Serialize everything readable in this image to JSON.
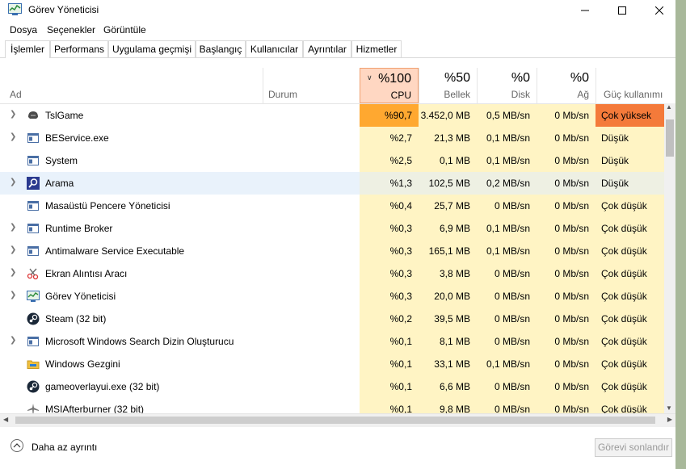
{
  "window": {
    "title": "Görev Yöneticisi"
  },
  "menu": [
    "Dosya",
    "Seçenekler",
    "Görüntüle"
  ],
  "tabs": [
    "İşlemler",
    "Performans",
    "Uygulama geçmişi",
    "Başlangıç",
    "Kullanıcılar",
    "Ayrıntılar",
    "Hizmetler"
  ],
  "columns": {
    "name": "Ad",
    "status": "Durum",
    "cpu": {
      "pct": "%100",
      "label": "CPU"
    },
    "mem": {
      "pct": "%50",
      "label": "Bellek"
    },
    "disk": {
      "pct": "%0",
      "label": "Disk"
    },
    "net": {
      "pct": "%0",
      "label": "Ağ"
    },
    "power": {
      "label": "Güç kullanımı"
    }
  },
  "processes": [
    {
      "name": "TslGame",
      "expand": true,
      "icon": "pubg-helmet-icon",
      "cpu": "%90,7",
      "mem": "3.452,0 MB",
      "disk": "0,5 MB/sn",
      "net": "0 Mb/sn",
      "power": "Çok yüksek"
    },
    {
      "name": "BEService.exe",
      "expand": true,
      "icon": "window-app-icon",
      "cpu": "%2,7",
      "mem": "21,3 MB",
      "disk": "0,1 MB/sn",
      "net": "0 Mb/sn",
      "power": "Düşük"
    },
    {
      "name": "System",
      "expand": false,
      "icon": "window-app-icon",
      "cpu": "%2,5",
      "mem": "0,1 MB",
      "disk": "0,1 MB/sn",
      "net": "0 Mb/sn",
      "power": "Düşük"
    },
    {
      "name": "Arama",
      "expand": true,
      "icon": "search-icon",
      "cpu": "%1,3",
      "mem": "102,5 MB",
      "disk": "0,2 MB/sn",
      "net": "0 Mb/sn",
      "power": "Düşük",
      "selected": true
    },
    {
      "name": "Masaüstü Pencere Yöneticisi",
      "expand": false,
      "icon": "window-app-icon",
      "cpu": "%0,4",
      "mem": "25,7 MB",
      "disk": "0 MB/sn",
      "net": "0 Mb/sn",
      "power": "Çok düşük"
    },
    {
      "name": "Runtime Broker",
      "expand": true,
      "icon": "window-app-icon",
      "cpu": "%0,3",
      "mem": "6,9 MB",
      "disk": "0,1 MB/sn",
      "net": "0 Mb/sn",
      "power": "Çok düşük"
    },
    {
      "name": "Antimalware Service Executable",
      "expand": true,
      "icon": "window-app-icon",
      "cpu": "%0,3",
      "mem": "165,1 MB",
      "disk": "0,1 MB/sn",
      "net": "0 Mb/sn",
      "power": "Çok düşük"
    },
    {
      "name": "Ekran Alıntısı Aracı",
      "expand": true,
      "icon": "scissors-icon",
      "cpu": "%0,3",
      "mem": "3,8 MB",
      "disk": "0 MB/sn",
      "net": "0 Mb/sn",
      "power": "Çok düşük"
    },
    {
      "name": "Görev Yöneticisi",
      "expand": true,
      "icon": "task-manager-icon",
      "cpu": "%0,3",
      "mem": "20,0 MB",
      "disk": "0 MB/sn",
      "net": "0 Mb/sn",
      "power": "Çok düşük"
    },
    {
      "name": "Steam (32 bit)",
      "expand": false,
      "icon": "steam-icon",
      "cpu": "%0,2",
      "mem": "39,5 MB",
      "disk": "0 MB/sn",
      "net": "0 Mb/sn",
      "power": "Çok düşük"
    },
    {
      "name": "Microsoft Windows Search Dizin Oluşturucu",
      "expand": true,
      "icon": "window-app-icon",
      "cpu": "%0,1",
      "mem": "8,1 MB",
      "disk": "0 MB/sn",
      "net": "0 Mb/sn",
      "power": "Çok düşük"
    },
    {
      "name": "Windows Gezgini",
      "expand": false,
      "icon": "folder-icon",
      "cpu": "%0,1",
      "mem": "33,1 MB",
      "disk": "0,1 MB/sn",
      "net": "0 Mb/sn",
      "power": "Çok düşük"
    },
    {
      "name": "gameoverlayui.exe (32 bit)",
      "expand": false,
      "icon": "steam-icon",
      "cpu": "%0,1",
      "mem": "6,6 MB",
      "disk": "0 MB/sn",
      "net": "0 Mb/sn",
      "power": "Çok düşük"
    },
    {
      "name": "MSIAfterburner (32 bit)",
      "expand": false,
      "icon": "airplane-icon",
      "cpu": "%0,1",
      "mem": "9,8 MB",
      "disk": "0 MB/sn",
      "net": "0 Mb/sn",
      "power": "Çok düşük"
    }
  ],
  "footer": {
    "less_details": "Daha az ayrıntı",
    "end_task": "Görevi sonlandır"
  },
  "colors": {
    "cpu_high": "#ffa830",
    "power_very_high": "#f47a3a",
    "cell_bg": "#fff4c4",
    "cpu_header_bg": "#ffd7c2"
  }
}
